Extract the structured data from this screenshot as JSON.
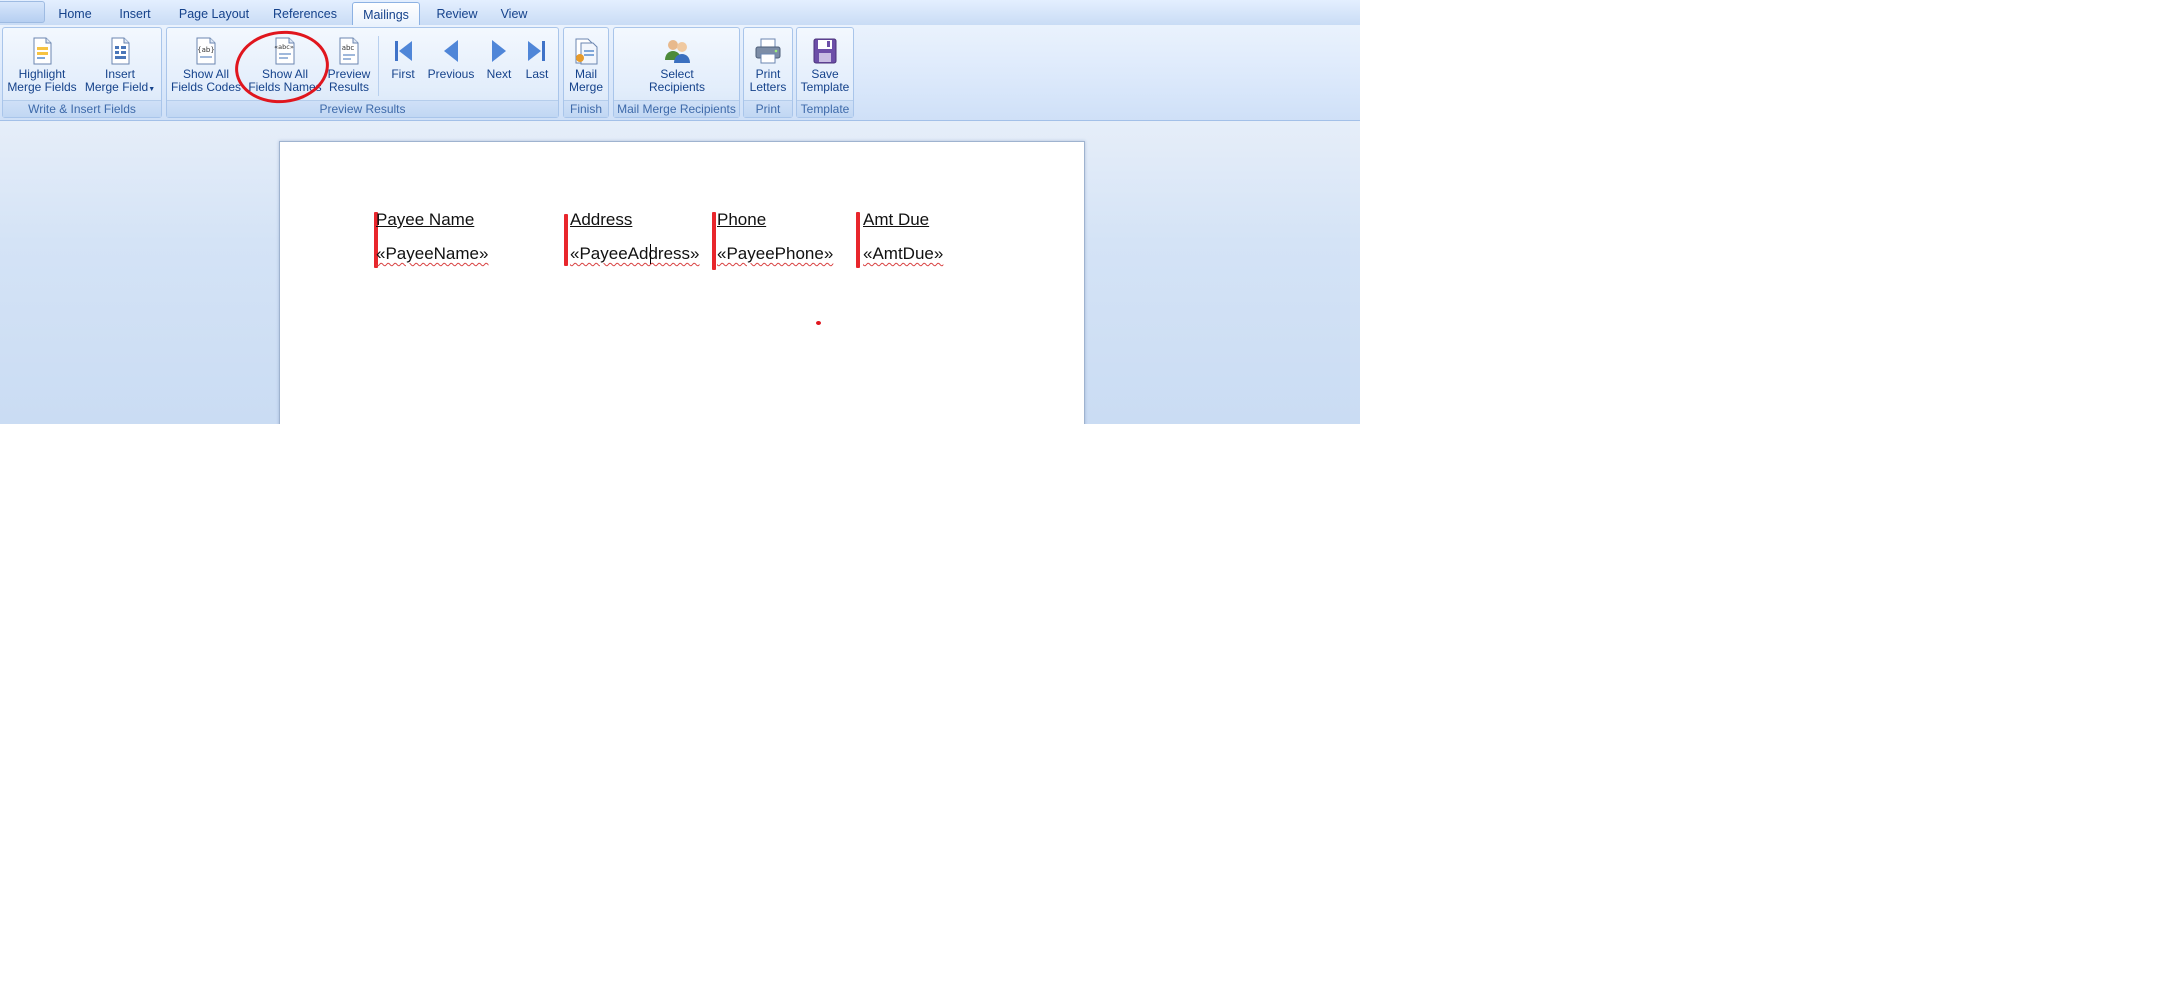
{
  "tabs": [
    "Home",
    "Insert",
    "Page Layout",
    "References",
    "Mailings",
    "Review",
    "View"
  ],
  "active_tab": "Mailings",
  "ribbon": {
    "groups": {
      "write_insert": "Write & Insert Fields",
      "preview_results": "Preview Results",
      "finish": "Finish",
      "recipients": "Mail Merge Recipients",
      "print": "Print",
      "template": "Template"
    },
    "buttons": {
      "highlight_line1": "Highlight",
      "highlight_line2": "Merge Fields",
      "insert_line1": "Insert",
      "insert_line2": "Merge Field",
      "show_codes_line1": "Show All",
      "show_codes_line2": "Fields Codes",
      "show_names_line1": "Show All",
      "show_names_line2": "Fields Names",
      "preview_line1": "Preview",
      "preview_line2": "Results",
      "first": "First",
      "previous": "Previous",
      "next": "Next",
      "last": "Last",
      "mail_merge_line1": "Mail",
      "mail_merge_line2": "Merge",
      "select_recipients_line1": "Select",
      "select_recipients_line2": "Recipients",
      "print_letters_line1": "Print",
      "print_letters_line2": "Letters",
      "save_template_line1": "Save",
      "save_template_line2": "Template"
    },
    "icon_text": {
      "codes": "{ab}",
      "names": "«abc»",
      "preview": "abc"
    }
  },
  "document": {
    "headers": [
      "Payee Name",
      "Address",
      "Phone",
      "Amt Due"
    ],
    "fields": [
      "«PayeeName»",
      "«PayeeAddress»",
      "«PayeePhone»",
      "«AmtDue»"
    ]
  },
  "colors": {
    "accent_red": "#e0161e",
    "ribbon_text": "#15428b"
  }
}
